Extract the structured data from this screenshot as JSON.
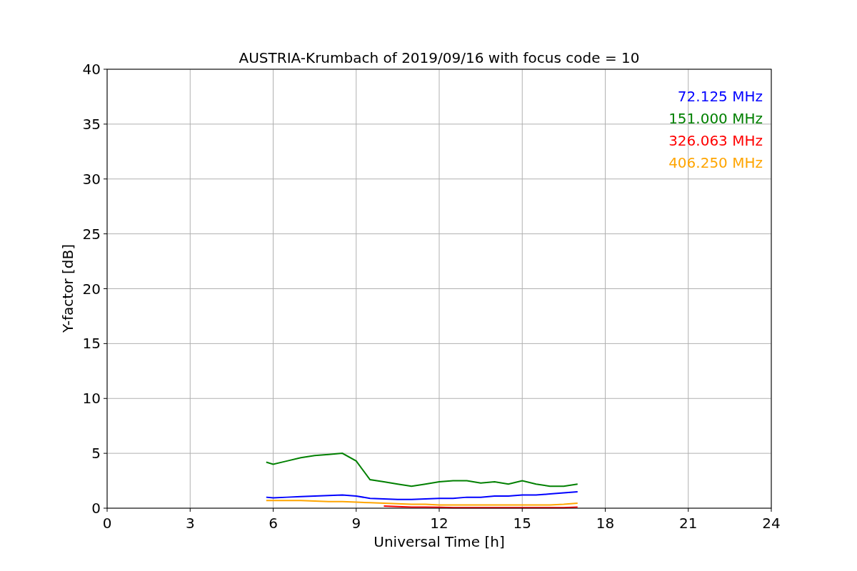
{
  "chart_data": {
    "type": "line",
    "title": "AUSTRIA-Krumbach of 2019/09/16 with focus code = 10",
    "xlabel": "Universal Time [h]",
    "ylabel": "Y-factor [dB]",
    "x": [
      5.75,
      6,
      6.5,
      7,
      7.5,
      8,
      8.5,
      9,
      9.5,
      10,
      10.5,
      11,
      11.5,
      12,
      12.5,
      13,
      13.5,
      14,
      14.5,
      15,
      15.5,
      16,
      16.5,
      17
    ],
    "series": [
      {
        "name": "72.125 MHz",
        "color": "#0000ff",
        "values": [
          1.0,
          0.95,
          1.0,
          1.05,
          1.1,
          1.15,
          1.2,
          1.1,
          0.9,
          0.85,
          0.8,
          0.8,
          0.85,
          0.9,
          0.9,
          1.0,
          1.0,
          1.1,
          1.1,
          1.2,
          1.2,
          1.3,
          1.4,
          1.5
        ]
      },
      {
        "name": "151.000 MHz",
        "color": "#008000",
        "values": [
          4.2,
          4.0,
          4.3,
          4.6,
          4.8,
          4.9,
          5.0,
          4.3,
          2.6,
          2.4,
          2.2,
          2.0,
          2.2,
          2.4,
          2.5,
          2.5,
          2.3,
          2.4,
          2.2,
          2.5,
          2.2,
          2.0,
          2.0,
          2.2
        ]
      },
      {
        "name": "326.063 MHz",
        "color": "#ff0000",
        "values": [
          null,
          null,
          null,
          null,
          null,
          null,
          null,
          null,
          null,
          0.2,
          0.15,
          0.1,
          0.1,
          0.08,
          0.05,
          0.05,
          0.05,
          0.05,
          0.05,
          0.05,
          0.05,
          0.05,
          0.05,
          0.1
        ]
      },
      {
        "name": "406.250 MHz",
        "color": "#ffa500",
        "values": [
          0.7,
          0.7,
          0.7,
          0.7,
          0.65,
          0.6,
          0.6,
          0.55,
          0.5,
          0.45,
          0.4,
          0.35,
          0.35,
          0.3,
          0.3,
          0.3,
          0.3,
          0.3,
          0.3,
          0.3,
          0.3,
          0.3,
          0.35,
          0.45
        ]
      }
    ],
    "xlim": [
      0,
      24
    ],
    "ylim": [
      0,
      40
    ],
    "grid": true,
    "xticks": [
      0,
      3,
      6,
      9,
      12,
      15,
      18,
      21,
      24
    ],
    "yticks": [
      0,
      5,
      10,
      15,
      20,
      25,
      30,
      35,
      40
    ]
  }
}
